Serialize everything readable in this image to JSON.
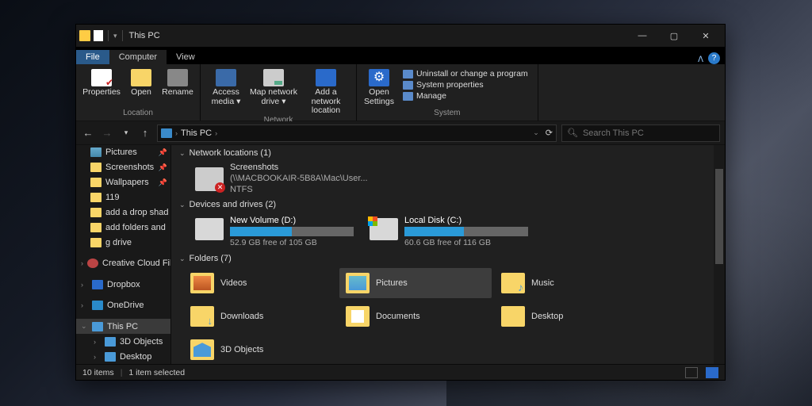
{
  "title": "This PC",
  "tabs": {
    "file": "File",
    "computer": "Computer",
    "view": "View"
  },
  "ribbon": {
    "location": {
      "label": "Location",
      "properties": "Properties",
      "open": "Open",
      "rename": "Rename"
    },
    "network": {
      "label": "Network",
      "access": "Access media ▾",
      "map": "Map network drive ▾",
      "add": "Add a network location"
    },
    "system": {
      "label": "System",
      "settings": "Open Settings",
      "uninstall": "Uninstall or change a program",
      "props": "System properties",
      "manage": "Manage"
    }
  },
  "address": {
    "crumb": "This PC"
  },
  "search": {
    "placeholder": "Search This PC"
  },
  "sidebar": {
    "quick": [
      {
        "label": "Pictures",
        "pin": true,
        "kind": "pic"
      },
      {
        "label": "Screenshots",
        "pin": true
      },
      {
        "label": "Wallpapers",
        "pin": true
      },
      {
        "label": "119"
      },
      {
        "label": "add a drop shad"
      },
      {
        "label": "add folders and"
      },
      {
        "label": "g drive"
      }
    ],
    "cc": "Creative Cloud File",
    "dropbox": "Dropbox",
    "onedrive": "OneDrive",
    "thispc": "This PC",
    "thispc_children": [
      "3D Objects",
      "Desktop"
    ]
  },
  "sections": {
    "net": {
      "label": "Network locations (1)"
    },
    "dev": {
      "label": "Devices and drives (2)"
    },
    "fold": {
      "label": "Folders (7)"
    }
  },
  "netloc": {
    "name": "Screenshots",
    "path": "(\\\\MACBOOKAIR-5B8A\\Mac\\User...",
    "fs": "NTFS"
  },
  "drives": [
    {
      "name": "New Volume (D:)",
      "free": "52.9 GB free of 105 GB",
      "pct": 50,
      "win": false
    },
    {
      "name": "Local Disk (C:)",
      "free": "60.6 GB free of 116 GB",
      "pct": 48,
      "win": true
    }
  ],
  "folders": [
    {
      "label": "Videos",
      "kind": "vid"
    },
    {
      "label": "Pictures",
      "kind": "pic",
      "selected": true
    },
    {
      "label": "Music",
      "kind": "mus"
    },
    {
      "label": "Downloads",
      "kind": "dl"
    },
    {
      "label": "Documents",
      "kind": "doc"
    },
    {
      "label": "Desktop",
      "kind": ""
    },
    {
      "label": "3D Objects",
      "kind": "obj3d"
    }
  ],
  "status": {
    "items": "10 items",
    "selected": "1 item selected"
  }
}
